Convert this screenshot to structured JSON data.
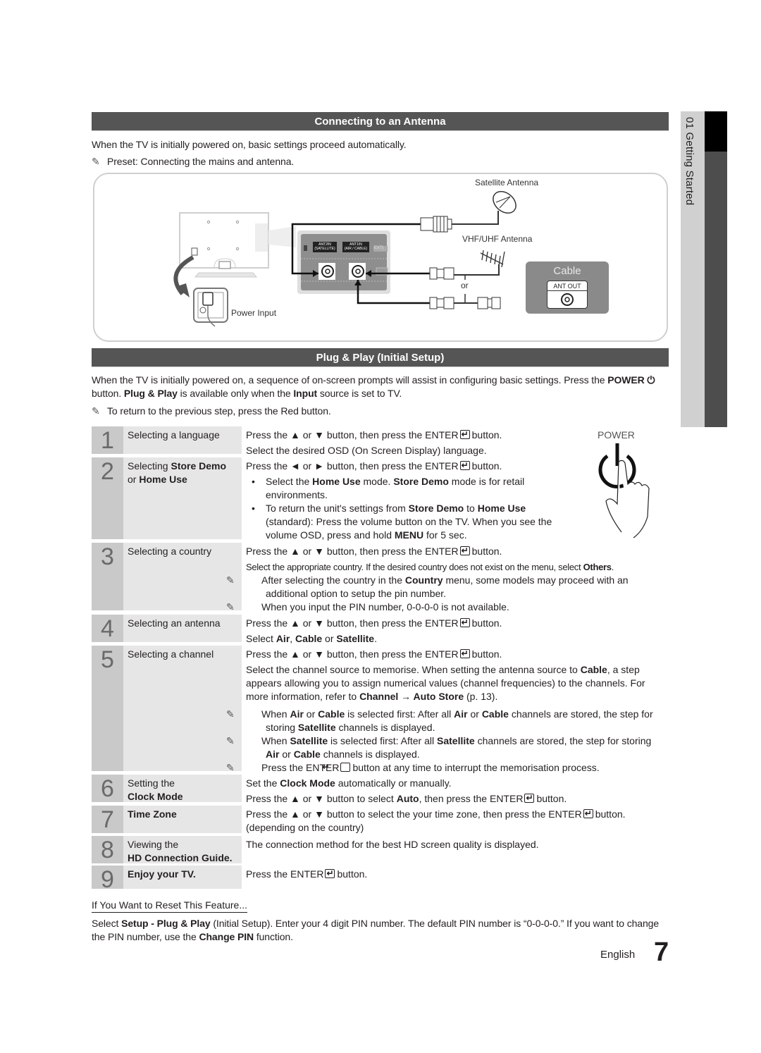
{
  "side_tab": {
    "chapter": "01 Getting Started"
  },
  "section1": {
    "title": "Connecting to an Antenna",
    "intro": "When the TV is initially powered on, basic settings proceed automatically.",
    "note": "Preset: Connecting the mains and antenna.",
    "diagram": {
      "satellite_label": "Satellite Antenna",
      "vhf_label": "VHF/UHF Antenna",
      "or_label": "or",
      "power_input_label": "Power Input",
      "ant2_label_line1": "ANT2IN",
      "ant2_label_line2": "(SATELLITE)",
      "ant1_label_line1": "ANT1IN",
      "ant1_label_line2": "(AIR / CABLE)",
      "ext_label": "EXT(",
      "cable_title": "Cable",
      "ant_out_label": "ANT OUT"
    }
  },
  "section2": {
    "title": "Plug & Play (Initial Setup)",
    "intro_part1": "When the TV is initially powered on, a sequence of on-screen prompts will assist in configuring basic settings. Press the",
    "intro_power": "POWER",
    "intro_part2": "button.",
    "intro_plugplay": "Plug & Play",
    "intro_part3": "is available only when the",
    "intro_input": "Input",
    "intro_part4": "source is set to TV.",
    "note": "To return to the previous step, press the Red button.",
    "power_figure_label": "POWER"
  },
  "steps": [
    {
      "num": "1",
      "title": "Selecting a language",
      "lines": [
        "Press the ▲ or ▼ button, then press the ENTER",
        "button.",
        "Select the desired OSD (On Screen Display) language."
      ]
    },
    {
      "num": "2",
      "title_a": "Selecting ",
      "title_b": "Store Demo",
      "title_c": "or ",
      "title_d": "Home Use",
      "line1a": "Press the ◄ or ► button, then press the ENTER",
      "line1b": "button.",
      "bullet1": [
        "Select the ",
        "Home Use",
        " mode. ",
        "Store Demo",
        " mode is for retail environments."
      ],
      "bullet2": [
        "To return the unit's settings from ",
        "Store Demo",
        " to ",
        "Home Use",
        " (standard): Press the volume button on the TV. When you see the volume OSD, press and hold ",
        "MENU",
        " for 5 sec."
      ]
    },
    {
      "num": "3",
      "title": "Selecting a country",
      "line1a": "Press the ▲ or ▼ button, then press the ENTER",
      "line1b": "button.",
      "line2a": "Select the appropriate country. If the desired country does not exist on the menu, select ",
      "line2b": "Others",
      "note1": [
        "After selecting the country in the ",
        "Country",
        " menu, some models may proceed with an additional option to setup the pin number."
      ],
      "note2": "When you input the PIN number, 0-0-0-0 is not available."
    },
    {
      "num": "4",
      "title": "Selecting an antenna",
      "line1a": "Press the ▲ or ▼ button, then press the ENTER",
      "line1b": "button.",
      "line2": [
        "Select ",
        "Air",
        ", ",
        "Cable",
        " or ",
        "Satellite",
        "."
      ]
    },
    {
      "num": "5",
      "title": "Selecting a channel",
      "line1a": "Press the ▲ or ▼ button, then press the ENTER",
      "line1b": "button.",
      "para": [
        "Select the channel source to memorise. When setting the antenna source to ",
        "Cable",
        ", a step appears allowing you to assign numerical values (channel frequencies) to the channels. For more information, refer to ",
        "Channel → Auto Store",
        " (p. 13)."
      ],
      "note1": [
        "When ",
        "Air",
        " or ",
        "Cable",
        " is selected first: After all ",
        "Air",
        " or ",
        "Cable",
        " channels are stored, the step for storing ",
        "Satellite",
        " channels is displayed."
      ],
      "note2": [
        "When ",
        "Satellite",
        " is selected first: After all ",
        "Satellite",
        " channels are stored, the step for storing ",
        "Air",
        " or ",
        "Cable",
        " channels is displayed."
      ],
      "note3a": "Press the ENTER",
      "note3b": "button at any time to interrupt the memorisation process."
    },
    {
      "num": "6",
      "title_a": "Setting the",
      "title_b": "Clock Mode",
      "line1": [
        "Set the ",
        "Clock Mode",
        " automatically or manually."
      ],
      "line2a": "Press the ▲ or ▼ button to select ",
      "line2b": "Auto",
      "line2c": ", then press the ENTER",
      "line2d": "button."
    },
    {
      "num": "7",
      "title": "Time Zone",
      "line1a": "Press the ▲ or ▼ button to select the your time zone, then press the ENTER",
      "line1b": "button.",
      "line2": "(depending on the country)"
    },
    {
      "num": "8",
      "title_a": "Viewing the",
      "title_b": "HD Connection Guide.",
      "line1": "The connection method for the best HD screen quality is displayed."
    },
    {
      "num": "9",
      "title": "Enjoy your TV.",
      "line1a": "Press the ENTER",
      "line1b": "button."
    }
  ],
  "reset": {
    "title": "If You Want to Reset This Feature...",
    "text": [
      "Select ",
      "Setup - Plug & Play",
      " (Initial Setup). Enter your 4 digit PIN number. The default PIN number is “0-0-0-0.” If you want to change the PIN number, use the ",
      "Change PIN",
      " function."
    ]
  },
  "footer": {
    "language": "English",
    "page": "7"
  }
}
